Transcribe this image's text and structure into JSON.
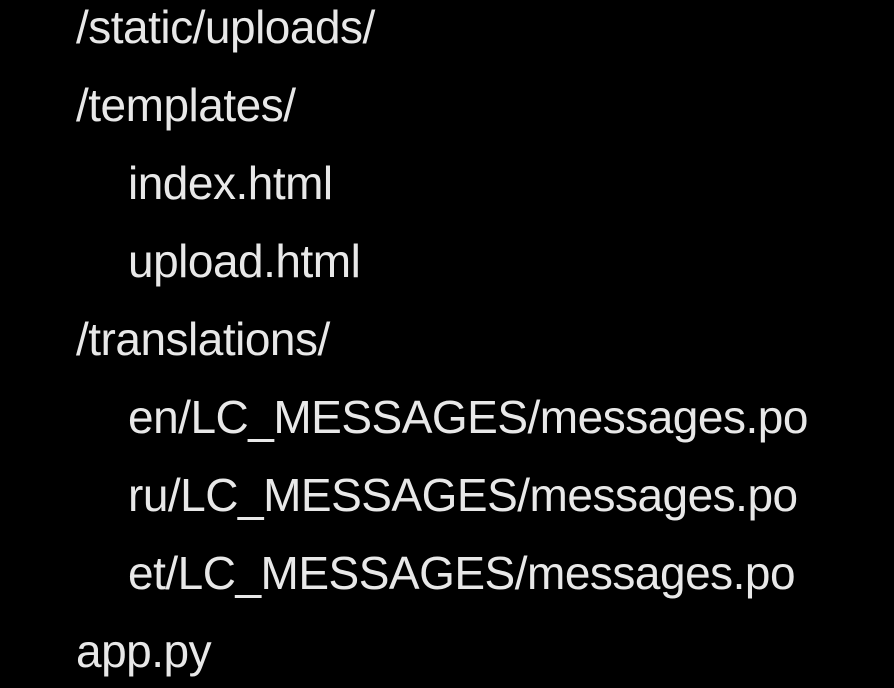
{
  "file_tree": {
    "items": [
      {
        "label": "/static/uploads/"
      },
      {
        "label": "/templates/"
      },
      {
        "label": "index.html"
      },
      {
        "label": "upload.html"
      },
      {
        "label": "/translations/"
      },
      {
        "label": "en/LC_MESSAGES/messages.po"
      },
      {
        "label": "ru/LC_MESSAGES/messages.po"
      },
      {
        "label": "et/LC_MESSAGES/messages.po"
      },
      {
        "label": "app.py"
      }
    ]
  },
  "colors": {
    "background": "#000000",
    "text": "#e8e8e8"
  }
}
